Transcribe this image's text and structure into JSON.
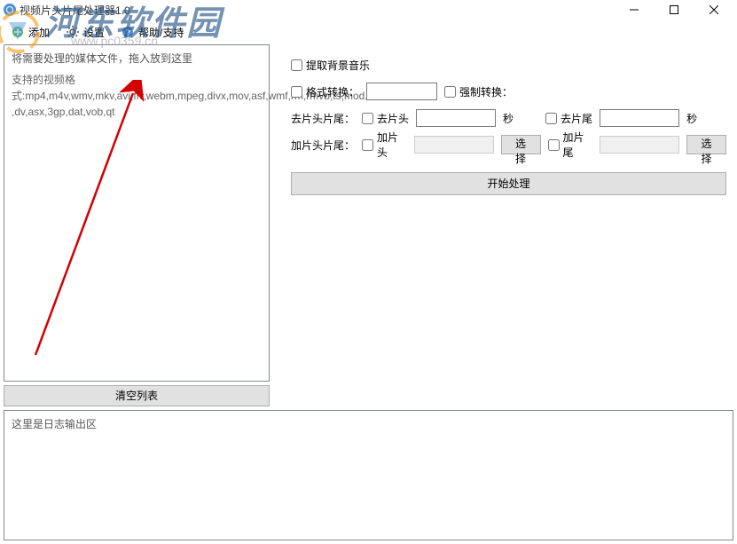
{
  "watermark": {
    "text": "河东软件园",
    "url": "www.pc0359.cn"
  },
  "titlebar": {
    "title": "视频片头片尾处理器1.0"
  },
  "menu": {
    "add": "添加",
    "settings": "设置",
    "help": "帮助/支持"
  },
  "drop": {
    "hint": "将需要处理的媒体文件，拖入放到这里",
    "formats_label": "支持的视频格式:",
    "formats": "mp4,m4v,wmv,mkv,avi,flv,webm,mpeg,divx,mov,asf,wmf,rm,rmvb,ts,mod,    ,dv,asx,3gp,dat,vob,qt"
  },
  "clear_list": "清空列表",
  "options": {
    "extract_audio": "提取背景音乐",
    "format_convert": "格式转换：",
    "force_convert": "强制转换：",
    "trim_label": "去片头片尾：",
    "trim_head": "去片头",
    "trim_tail": "去片尾",
    "add_label": "加片头片尾：",
    "add_head": "加片头",
    "add_tail": "加片尾",
    "seconds": "秒",
    "select": "选择"
  },
  "start": "开始处理",
  "log_placeholder": "这里是日志输出区"
}
